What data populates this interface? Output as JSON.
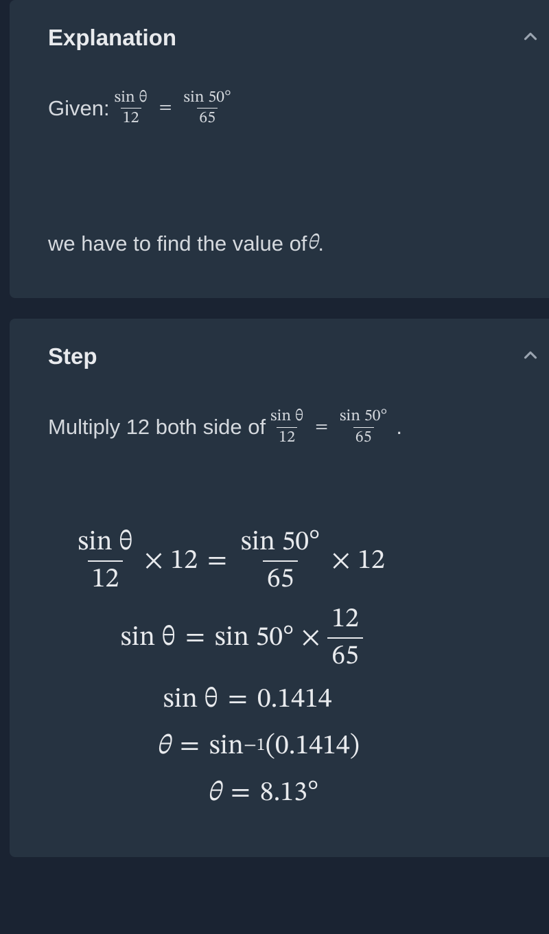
{
  "explanation": {
    "title": "Explanation",
    "given_label": "Given: ",
    "frac1_num": "sin θ",
    "frac1_den": "12",
    "frac2_num": "sin 50°",
    "frac2_den": "65",
    "task": "we have to find the value of ",
    "task_var": "θ",
    "task_period": "."
  },
  "step": {
    "title": "Step",
    "instr_a": "Multiply 12 both side of ",
    "frac1_num": "sin θ",
    "frac1_den": "12",
    "frac2_num": "sin 50°",
    "frac2_den": "65",
    "period": ".",
    "work": {
      "r1": {
        "lnum": "sin θ",
        "lden": "12",
        "lfactor": "12",
        "rnum": "sin 50°",
        "rden": "65",
        "rfactor": "12"
      },
      "r2": {
        "lhs": "sin θ",
        "rfactor": "sin 50°",
        "fnum": "12",
        "fden": "65"
      },
      "r3": {
        "lhs": "sin θ",
        "rhs": "0.1414"
      },
      "r4": {
        "lhs": "θ",
        "fn": "sin",
        "exp": "−1",
        "arg": "(0.1414)"
      },
      "r5": {
        "lhs": "θ",
        "rhs": "8.13°"
      }
    }
  }
}
